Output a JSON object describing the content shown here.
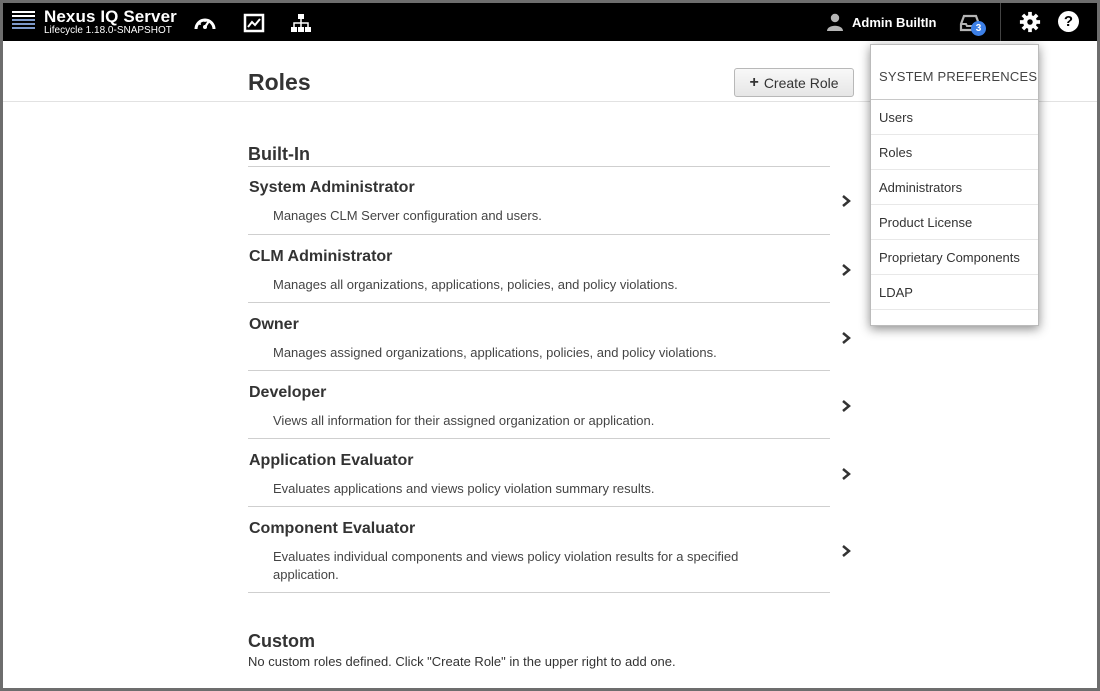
{
  "app": {
    "title": "Nexus IQ Server",
    "subtitle": "Lifecycle 1.18.0-SNAPSHOT"
  },
  "header": {
    "nav_icons": [
      "dashboard-icon",
      "reports-icon",
      "organizations-icon"
    ],
    "user_name": "Admin BuiltIn",
    "inbox_count": "3",
    "help_label": "?"
  },
  "page": {
    "title": "Roles",
    "create_button": "Create Role",
    "create_button_icon": "+"
  },
  "builtin": {
    "title": "Built-In",
    "roles": [
      {
        "name": "System Administrator",
        "description": "Manages CLM Server configuration and users."
      },
      {
        "name": "CLM Administrator",
        "description": "Manages all organizations, applications, policies, and policy violations."
      },
      {
        "name": "Owner",
        "description": "Manages assigned organizations, applications, policies, and policy violations."
      },
      {
        "name": "Developer",
        "description": "Views all information for their assigned organization or application."
      },
      {
        "name": "Application Evaluator",
        "description": "Evaluates applications and views policy violation summary results."
      },
      {
        "name": "Component Evaluator",
        "description": "Evaluates individual components and views policy violation results for a specified application."
      }
    ]
  },
  "custom": {
    "title": "Custom",
    "empty_message": "No custom roles defined. Click \"Create Role\" in the upper right to add one."
  },
  "preferences_menu": {
    "title": "SYSTEM PREFERENCES",
    "items": [
      "Users",
      "Roles",
      "Administrators",
      "Product License",
      "Proprietary Components",
      "LDAP"
    ]
  },
  "colors": {
    "topbar": "#000000",
    "badge": "#3c7fe6",
    "text": "#333333",
    "rule": "#cfcfcf"
  }
}
